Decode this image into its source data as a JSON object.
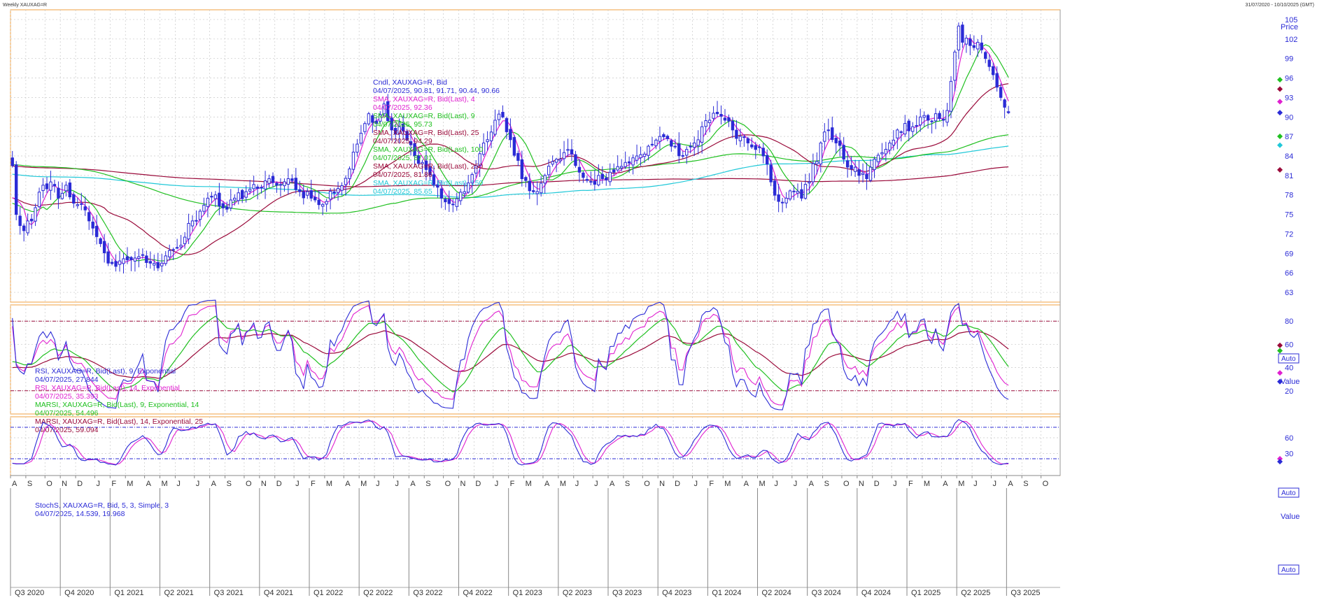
{
  "window": {
    "title": "Weekly XAUXAG=R",
    "date_range": "31/07/2020 - 10/10/2025 (GMT)"
  },
  "chart_data": {
    "type": "candlestick",
    "symbol": "XAUXAG=R",
    "colors": {
      "candle": "#2b2bd6",
      "sma4": "#e020d0",
      "sma9": "#20c020",
      "sma25": "#9a0a3a",
      "sma100": "#20c020",
      "sma150": "#20c8d8",
      "sma250": "#9a0a3a",
      "orange_border": "#f0a040",
      "grid": "#c8c8c8"
    },
    "price_panel": {
      "axis_label": "Price",
      "auto_label": "Auto",
      "y_ticks": [
        63,
        66,
        69,
        72,
        75,
        78,
        81,
        84,
        87,
        90,
        93,
        96,
        99,
        102,
        105
      ],
      "ylim": [
        61.5,
        106.5
      ],
      "legend": [
        {
          "name": "Cndl, XAUXAG=R, Bid",
          "value": "04/07/2025, 90.81, 91.71, 90.44, 90.66",
          "color": "#2b2bd6"
        },
        {
          "name": "SMA, XAUXAG=R, Bid(Last), 4",
          "value": "04/07/2025, 92.36",
          "color": "#e020d0"
        },
        {
          "name": "SMA, XAUXAG=R, Bid(Last), 9",
          "value": "04/07/2025, 95.73",
          "color": "#20c020"
        },
        {
          "name": "SMA, XAUXAG=R, Bid(Last), 25",
          "value": "04/07/2025, 94.29",
          "color": "#9a0a3a"
        },
        {
          "name": "SMA, XAUXAG=R, Bid(Last), 100",
          "value": "04/07/2025, 87.01",
          "color": "#20c020"
        },
        {
          "name": "SMA, XAUXAG=R, Bid(Last), 250",
          "value": "04/07/2025, 81.86",
          "color": "#9a0a3a"
        },
        {
          "name": "SMA, XAUXAG=R, Bid(Last), 150",
          "value": "04/07/2025, 85.65",
          "color": "#20c8d8"
        }
      ],
      "anchors_close": [
        [
          0,
          82.5
        ],
        [
          1,
          75.0
        ],
        [
          3,
          72.5
        ],
        [
          5,
          74.0
        ],
        [
          8,
          79.5
        ],
        [
          10,
          80.0
        ],
        [
          12,
          77.5
        ],
        [
          14,
          79.5
        ],
        [
          17,
          76.5
        ],
        [
          20,
          74.0
        ],
        [
          23,
          70.5
        ],
        [
          25,
          67.5
        ],
        [
          27,
          67.0
        ],
        [
          30,
          68.0
        ],
        [
          33,
          68.5
        ],
        [
          36,
          67.5
        ],
        [
          39,
          67.5
        ],
        [
          42,
          69.5
        ],
        [
          45,
          71.5
        ],
        [
          47,
          74.0
        ],
        [
          49,
          75.5
        ],
        [
          51,
          77.5
        ],
        [
          53,
          78.0
        ],
        [
          55,
          76.0
        ],
        [
          58,
          77.5
        ],
        [
          61,
          78.5
        ],
        [
          64,
          79.0
        ],
        [
          67,
          80.5
        ],
        [
          70,
          79.5
        ],
        [
          72,
          80.5
        ],
        [
          75,
          78.5
        ],
        [
          78,
          77.5
        ],
        [
          80,
          76.5
        ],
        [
          82,
          77.0
        ],
        [
          85,
          79.0
        ],
        [
          88,
          82.0
        ],
        [
          91,
          87.5
        ],
        [
          93,
          90.5
        ],
        [
          95,
          89.0
        ],
        [
          97,
          92.0
        ],
        [
          99,
          88.0
        ],
        [
          101,
          88.5
        ],
        [
          103,
          86.5
        ],
        [
          105,
          84.0
        ],
        [
          107,
          83.0
        ],
        [
          110,
          79.5
        ],
        [
          112,
          77.5
        ],
        [
          115,
          76.5
        ],
        [
          118,
          78.5
        ],
        [
          121,
          82.5
        ],
        [
          124,
          86.5
        ],
        [
          126,
          89.5
        ],
        [
          128,
          90.0
        ],
        [
          130,
          86.5
        ],
        [
          133,
          80.5
        ],
        [
          136,
          78.5
        ],
        [
          139,
          81.0
        ],
        [
          142,
          83.5
        ],
        [
          145,
          85.0
        ],
        [
          148,
          81.5
        ],
        [
          151,
          80.0
        ],
        [
          154,
          80.5
        ],
        [
          157,
          81.5
        ],
        [
          160,
          83.0
        ],
        [
          163,
          84.0
        ],
        [
          166,
          85.5
        ],
        [
          169,
          87.0
        ],
        [
          172,
          85.5
        ],
        [
          175,
          84.0
        ],
        [
          178,
          86.0
        ],
        [
          180,
          88.5
        ],
        [
          182,
          89.5
        ],
        [
          184,
          90.5
        ],
        [
          186,
          89.5
        ],
        [
          188,
          88.0
        ],
        [
          190,
          87.0
        ],
        [
          192,
          86.0
        ],
        [
          194,
          85.0
        ],
        [
          196,
          84.0
        ],
        [
          198,
          80.0
        ],
        [
          200,
          77.0
        ],
        [
          202,
          77.5
        ],
        [
          204,
          78.5
        ],
        [
          206,
          77.5
        ],
        [
          208,
          80.0
        ],
        [
          211,
          86.0
        ],
        [
          213,
          88.0
        ],
        [
          215,
          86.0
        ],
        [
          217,
          83.5
        ],
        [
          219,
          82.0
        ],
        [
          221,
          81.0
        ],
        [
          223,
          80.5
        ],
        [
          225,
          83.5
        ],
        [
          227,
          84.5
        ],
        [
          229,
          86.0
        ],
        [
          231,
          88.0
        ],
        [
          233,
          89.0
        ],
        [
          235,
          88.5
        ],
        [
          237,
          90.0
        ],
        [
          239,
          89.5
        ],
        [
          241,
          90.5
        ],
        [
          243,
          89.5
        ],
        [
          244,
          91.0
        ],
        [
          246,
          100.0
        ],
        [
          247,
          104.0
        ],
        [
          248,
          101.5
        ],
        [
          250,
          101.0
        ],
        [
          252,
          101.5
        ],
        [
          254,
          99.0
        ],
        [
          256,
          96.5
        ],
        [
          258,
          93.0
        ],
        [
          259,
          91.5
        ],
        [
          260,
          90.66
        ]
      ]
    },
    "rsi_panel": {
      "axis_label": "Value",
      "auto_label": "Auto",
      "y_ticks": [
        20,
        40,
        60,
        80
      ],
      "ylim": [
        0,
        94
      ],
      "levels": [
        20,
        80
      ],
      "legend": [
        {
          "name": "RSI, XAUXAG=R, Bid(Last), 9, Exponential",
          "value": "04/07/2025, 27.844",
          "color": "#2b2bd6"
        },
        {
          "name": "RSI, XAUXAG=R, Bid(Last), 14, Exponential",
          "value": "04/07/2025, 35.393",
          "color": "#e020d0"
        },
        {
          "name": "MARSI, XAUXAG=R, Bid(Last), 9, Exponential, 14",
          "value": "04/07/2025, 54.496",
          "color": "#20c020"
        },
        {
          "name": "MARSI, XAUXAG=R, Bid(Last), 14, Exponential, 25",
          "value": "04/07/2025, 59.094",
          "color": "#9a0a3a"
        }
      ]
    },
    "stoch_panel": {
      "axis_label": "Value",
      "y_ticks": [
        30,
        60
      ],
      "ylim": [
        -12,
        100
      ],
      "levels": [
        20,
        80
      ],
      "legend": [
        {
          "name": "StochS, XAUXAG=R, Bid, 5, 3, Simple, 3",
          "value": "04/07/2025, 14.539, 19.968",
          "color": "#2b2bd6"
        }
      ]
    },
    "x_axis": {
      "total_weeks": 274,
      "month_ticks": [
        {
          "w": 0,
          "t": "A"
        },
        {
          "w": 4,
          "t": "S"
        },
        {
          "w": 9,
          "t": "O"
        },
        {
          "w": 13,
          "t": "N"
        },
        {
          "w": 17,
          "t": "D"
        },
        {
          "w": 22,
          "t": "J"
        },
        {
          "w": 26,
          "t": "F"
        },
        {
          "w": 30,
          "t": "M"
        },
        {
          "w": 35,
          "t": "A"
        },
        {
          "w": 39,
          "t": "M"
        },
        {
          "w": 43,
          "t": "J"
        },
        {
          "w": 48,
          "t": "J"
        },
        {
          "w": 52,
          "t": "A"
        },
        {
          "w": 56,
          "t": "S"
        },
        {
          "w": 61,
          "t": "O"
        },
        {
          "w": 65,
          "t": "N"
        },
        {
          "w": 69,
          "t": "D"
        },
        {
          "w": 74,
          "t": "J"
        },
        {
          "w": 78,
          "t": "F"
        },
        {
          "w": 82,
          "t": "M"
        },
        {
          "w": 87,
          "t": "A"
        },
        {
          "w": 91,
          "t": "M"
        },
        {
          "w": 95,
          "t": "J"
        },
        {
          "w": 100,
          "t": "J"
        },
        {
          "w": 104,
          "t": "A"
        },
        {
          "w": 108,
          "t": "S"
        },
        {
          "w": 113,
          "t": "O"
        },
        {
          "w": 117,
          "t": "N"
        },
        {
          "w": 121,
          "t": "D"
        },
        {
          "w": 126,
          "t": "J"
        },
        {
          "w": 130,
          "t": "F"
        },
        {
          "w": 134,
          "t": "M"
        },
        {
          "w": 139,
          "t": "A"
        },
        {
          "w": 143,
          "t": "M"
        },
        {
          "w": 147,
          "t": "J"
        },
        {
          "w": 152,
          "t": "J"
        },
        {
          "w": 156,
          "t": "A"
        },
        {
          "w": 160,
          "t": "S"
        },
        {
          "w": 165,
          "t": "O"
        },
        {
          "w": 169,
          "t": "N"
        },
        {
          "w": 173,
          "t": "D"
        },
        {
          "w": 178,
          "t": "J"
        },
        {
          "w": 182,
          "t": "F"
        },
        {
          "w": 186,
          "t": "M"
        },
        {
          "w": 191,
          "t": "A"
        },
        {
          "w": 195,
          "t": "M"
        },
        {
          "w": 199,
          "t": "J"
        },
        {
          "w": 204,
          "t": "J"
        },
        {
          "w": 208,
          "t": "A"
        },
        {
          "w": 212,
          "t": "S"
        },
        {
          "w": 217,
          "t": "O"
        },
        {
          "w": 221,
          "t": "N"
        },
        {
          "w": 225,
          "t": "D"
        },
        {
          "w": 230,
          "t": "J"
        },
        {
          "w": 234,
          "t": "F"
        },
        {
          "w": 238,
          "t": "M"
        },
        {
          "w": 243,
          "t": "A"
        },
        {
          "w": 247,
          "t": "M"
        },
        {
          "w": 251,
          "t": "J"
        },
        {
          "w": 256,
          "t": "J"
        },
        {
          "w": 260,
          "t": "A"
        },
        {
          "w": 264,
          "t": "S"
        },
        {
          "w": 269,
          "t": "O"
        }
      ],
      "quarter_ticks": [
        {
          "w": 0,
          "t": "Q3 2020"
        },
        {
          "w": 13,
          "t": "Q4 2020"
        },
        {
          "w": 26,
          "t": "Q1 2021"
        },
        {
          "w": 39,
          "t": "Q2 2021"
        },
        {
          "w": 52,
          "t": "Q3 2021"
        },
        {
          "w": 65,
          "t": "Q4 2021"
        },
        {
          "w": 78,
          "t": "Q1 2022"
        },
        {
          "w": 91,
          "t": "Q2 2022"
        },
        {
          "w": 104,
          "t": "Q3 2022"
        },
        {
          "w": 117,
          "t": "Q4 2022"
        },
        {
          "w": 130,
          "t": "Q1 2023"
        },
        {
          "w": 143,
          "t": "Q2 2023"
        },
        {
          "w": 156,
          "t": "Q3 2023"
        },
        {
          "w": 169,
          "t": "Q4 2023"
        },
        {
          "w": 182,
          "t": "Q1 2024"
        },
        {
          "w": 195,
          "t": "Q2 2024"
        },
        {
          "w": 208,
          "t": "Q3 2024"
        },
        {
          "w": 221,
          "t": "Q4 2024"
        },
        {
          "w": 234,
          "t": "Q1 2025"
        },
        {
          "w": 247,
          "t": "Q2 2025"
        },
        {
          "w": 260,
          "t": "Q3 2025"
        }
      ]
    }
  }
}
